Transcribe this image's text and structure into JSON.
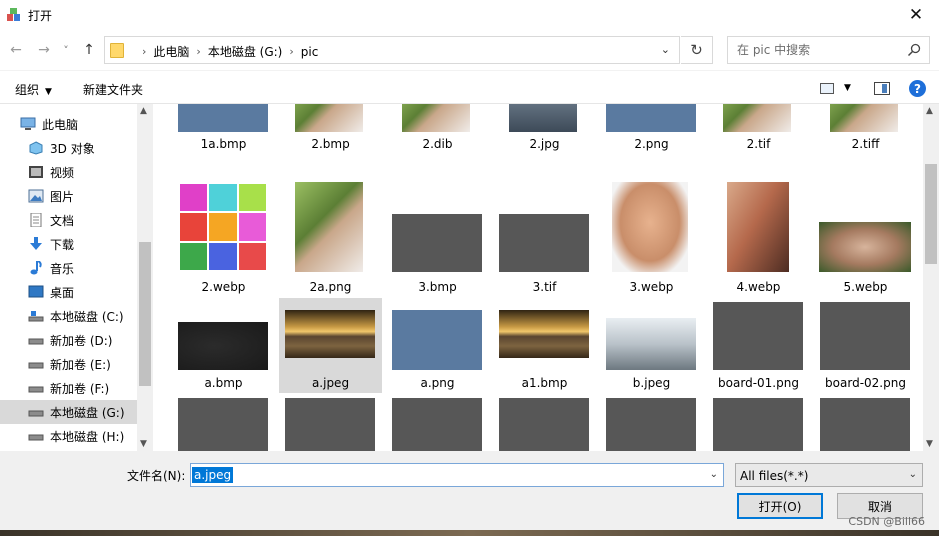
{
  "window": {
    "title": "打开",
    "close_glyph": "✕"
  },
  "nav": {
    "back_glyph": "←",
    "forward_glyph": "→",
    "recent_glyph": "˅",
    "up_glyph": "↑",
    "breadcrumbs": [
      "此电脑",
      "本地磁盘 (G:)",
      "pic"
    ],
    "refresh_glyph": "↻",
    "search_placeholder": "在 pic 中搜索"
  },
  "toolbar": {
    "organize": "组织",
    "new_folder": "新建文件夹",
    "help": "?"
  },
  "sidebar": {
    "items": [
      {
        "label": "此电脑",
        "icon": "computer-icon",
        "selected": false
      },
      {
        "label": "3D 对象",
        "icon": "3d-objects-icon",
        "selected": false
      },
      {
        "label": "视频",
        "icon": "video-icon",
        "selected": false
      },
      {
        "label": "图片",
        "icon": "pictures-icon",
        "selected": false
      },
      {
        "label": "文档",
        "icon": "documents-icon",
        "selected": false
      },
      {
        "label": "下载",
        "icon": "download-icon",
        "selected": false
      },
      {
        "label": "音乐",
        "icon": "music-icon",
        "selected": false
      },
      {
        "label": "桌面",
        "icon": "desktop-icon",
        "selected": false
      },
      {
        "label": "本地磁盘 (C:)",
        "icon": "drive-icon",
        "selected": false
      },
      {
        "label": "新加卷 (D:)",
        "icon": "drive-icon",
        "selected": false
      },
      {
        "label": "新加卷 (E:)",
        "icon": "drive-icon",
        "selected": false
      },
      {
        "label": "新加卷 (F:)",
        "icon": "drive-icon",
        "selected": false
      },
      {
        "label": "本地磁盘 (G:)",
        "icon": "drive-icon",
        "selected": true
      },
      {
        "label": "本地磁盘 (H:)",
        "icon": "drive-icon",
        "selected": false
      }
    ]
  },
  "files": {
    "row1": [
      "1a.bmp",
      "2.bmp",
      "2.dib",
      "2.jpg",
      "2.png",
      "2.tif",
      "2.tiff"
    ],
    "row2": [
      "2.webp",
      "2a.png",
      "3.bmp",
      "3.tif",
      "3.webp",
      "4.webp",
      "5.webp"
    ],
    "row3": [
      "a.bmp",
      "a.jpeg",
      "a.png",
      "a1.bmp",
      "b.jpeg",
      "board-01.png",
      "board-02.png"
    ],
    "selected": "a.jpeg"
  },
  "bottom": {
    "filename_label": "文件名(N):",
    "filename_value": "a.jpeg",
    "filetype": "All files(*.*)",
    "open_button": "打开(O)",
    "cancel_button": "取消",
    "watermark": "CSDN @Bill66"
  },
  "colors": {
    "accent": "#0078d7",
    "selection_bg": "#d9d9d9",
    "help_icon": "#1e6fd9"
  }
}
